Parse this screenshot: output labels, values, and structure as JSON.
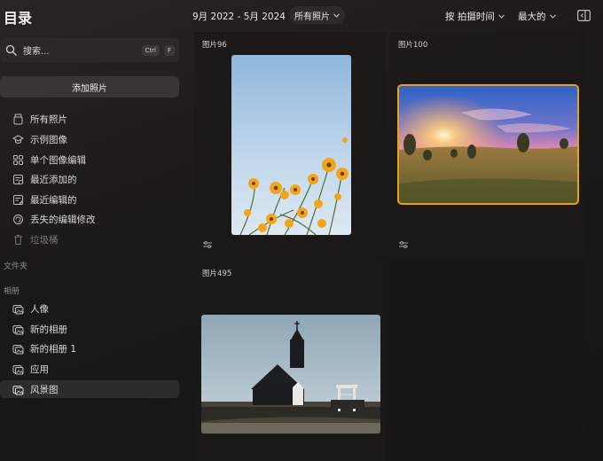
{
  "app": {
    "title": "目录"
  },
  "sidebar": {
    "search": {
      "placeholder": "搜索...",
      "shortcut_ctrl": "Ctrl",
      "shortcut_key": "F"
    },
    "add_button": "添加照片",
    "nav_items": [
      {
        "label": "所有照片",
        "icon": "photos-stack-icon"
      },
      {
        "label": "示例图像",
        "icon": "graduation-cap-icon"
      },
      {
        "label": "单个图像编辑",
        "icon": "grid-icon"
      },
      {
        "label": "最近添加的",
        "icon": "recent-added-icon"
      },
      {
        "label": "最近编辑的",
        "icon": "recent-edited-icon"
      },
      {
        "label": "丢失的编辑修改",
        "icon": "lost-edits-icon"
      },
      {
        "label": "垃圾桶",
        "icon": "trash-icon"
      }
    ],
    "folders_label": "文件夹",
    "albums_label": "相册",
    "albums": [
      {
        "label": "人像",
        "icon": "album-icon"
      },
      {
        "label": "新的相册",
        "icon": "album-icon"
      },
      {
        "label": "新的相册 1",
        "icon": "album-icon"
      },
      {
        "label": "应用",
        "icon": "album-icon"
      },
      {
        "label": "风景图",
        "icon": "album-icon",
        "selected": true
      }
    ]
  },
  "header": {
    "date_range": "9月 2022 - 5月 2024",
    "filter": "所有照片",
    "sort": "按 拍摄时间",
    "size": "最大的"
  },
  "grid": {
    "items": [
      {
        "label": "图片96",
        "subject": "yellow flowers against sky"
      },
      {
        "label": "图片100",
        "subject": "sunrise over meadow",
        "selected": true
      },
      {
        "label": "图片495",
        "subject": "black church"
      }
    ]
  },
  "colors": {
    "selection": "#e8a11a",
    "background": "#1d1917"
  }
}
